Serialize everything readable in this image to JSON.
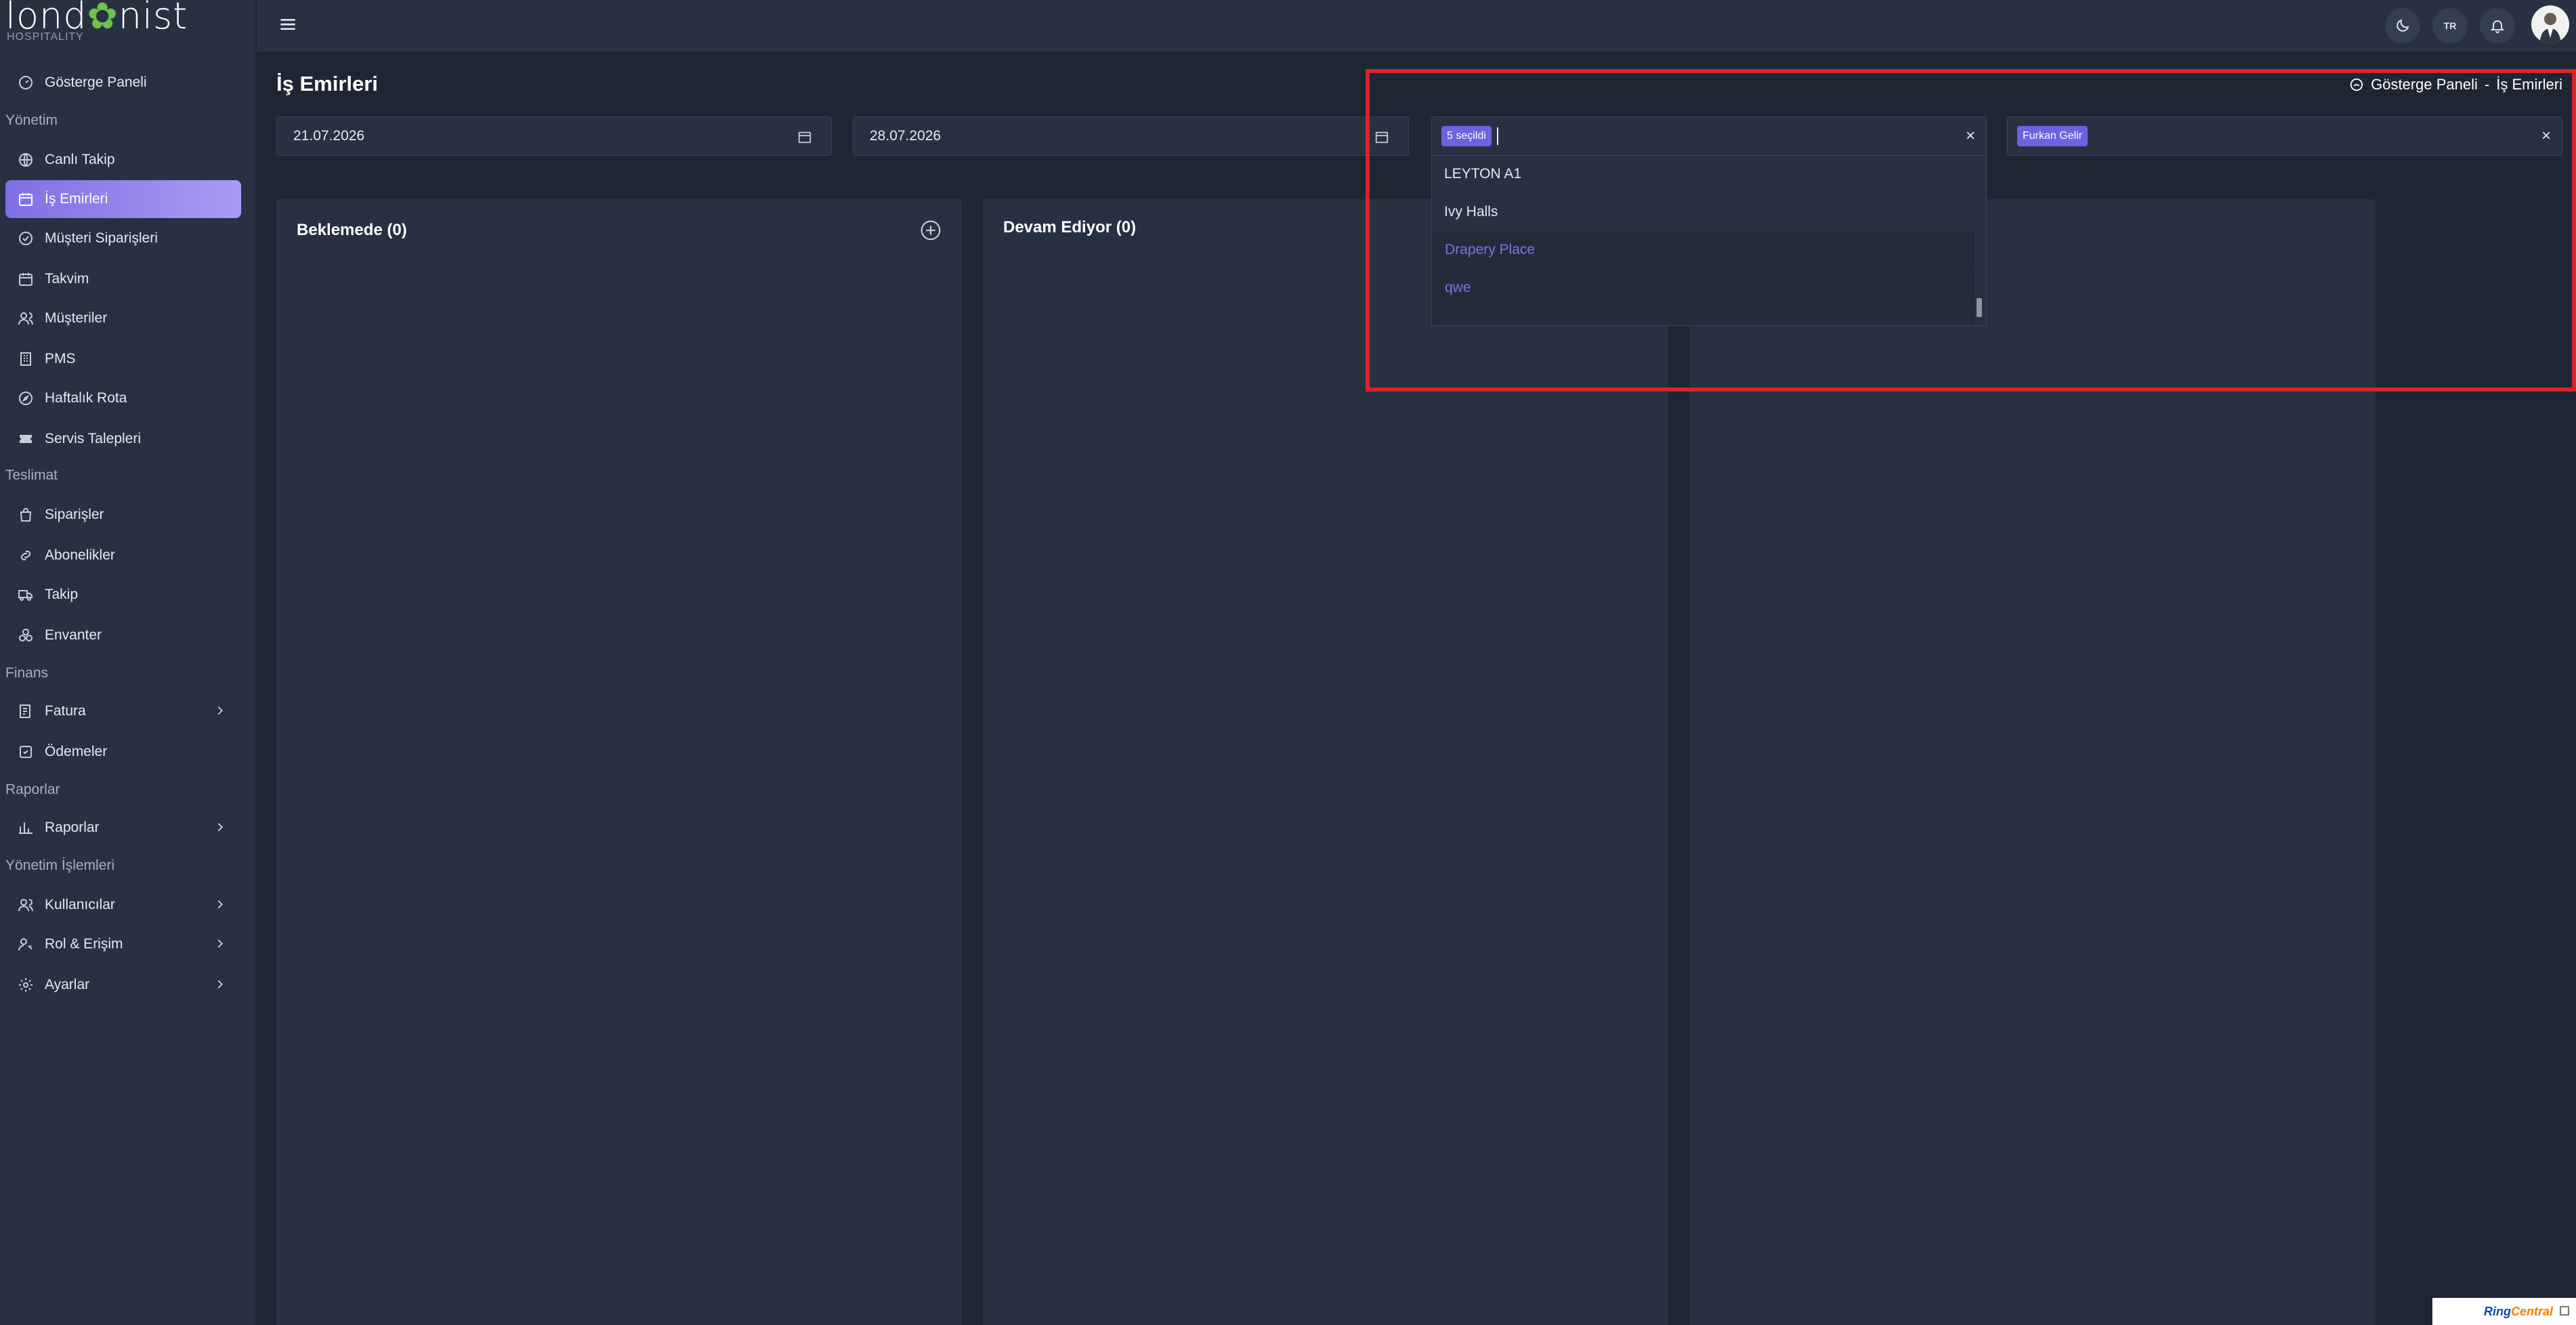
{
  "brand": {
    "name": "londonist",
    "name_part1": "lond",
    "name_part2": "nist",
    "tagline": "HOSPITALITY"
  },
  "sidebar": {
    "dashboard": "Gösterge Paneli",
    "sections": {
      "yonetim": "Yönetim",
      "teslimat": "Teslimat",
      "finans": "Finans",
      "raporlar": "Raporlar",
      "yonetim_islemleri": "Yönetim İşlemleri"
    },
    "items": {
      "canli_takip": "Canlı Takip",
      "is_emirleri": "İş Emirleri",
      "musteri_siparisleri": "Müşteri Siparişleri",
      "takvim": "Takvim",
      "musteriler": "Müşteriler",
      "pms": "PMS",
      "haftalik_rota": "Haftalık Rota",
      "servis_talepleri": "Servis Talepleri",
      "siparisler": "Siparişler",
      "abonelikler": "Abonelikler",
      "takip": "Takip",
      "envanter": "Envanter",
      "fatura": "Fatura",
      "odemeler": "Ödemeler",
      "raporlar": "Raporlar",
      "kullanicilar": "Kullanıcılar",
      "rol_erisim": "Rol & Erişim",
      "ayarlar": "Ayarlar"
    }
  },
  "topbar": {
    "language": "TR"
  },
  "page": {
    "title": "İş Emirleri",
    "breadcrumb": {
      "home": "Gösterge Paneli",
      "separator": "-",
      "current": "İş Emirleri"
    }
  },
  "filters": {
    "start_date": "21.07.2026",
    "end_date": "28.07.2026",
    "property_chip": "5 seçildi",
    "staff_chip": "Furkan Gelir",
    "clear_symbol": "×"
  },
  "dropdown": {
    "options": [
      {
        "label": "LEYTON A1",
        "selected": false
      },
      {
        "label": "Ivy Halls",
        "selected": false
      },
      {
        "label": "Drapery Place",
        "selected": true
      },
      {
        "label": "qwe",
        "selected": true
      }
    ]
  },
  "board": {
    "columns": [
      {
        "title": "Beklemede (0)"
      },
      {
        "title": "Devam Ediyor (0)"
      }
    ]
  },
  "widget": {
    "brand_a": "Ring",
    "brand_b": "Central"
  },
  "colors": {
    "accent": "#7b73ea",
    "highlight": "#d8232a",
    "logo_leaf": "#6fc24a"
  }
}
